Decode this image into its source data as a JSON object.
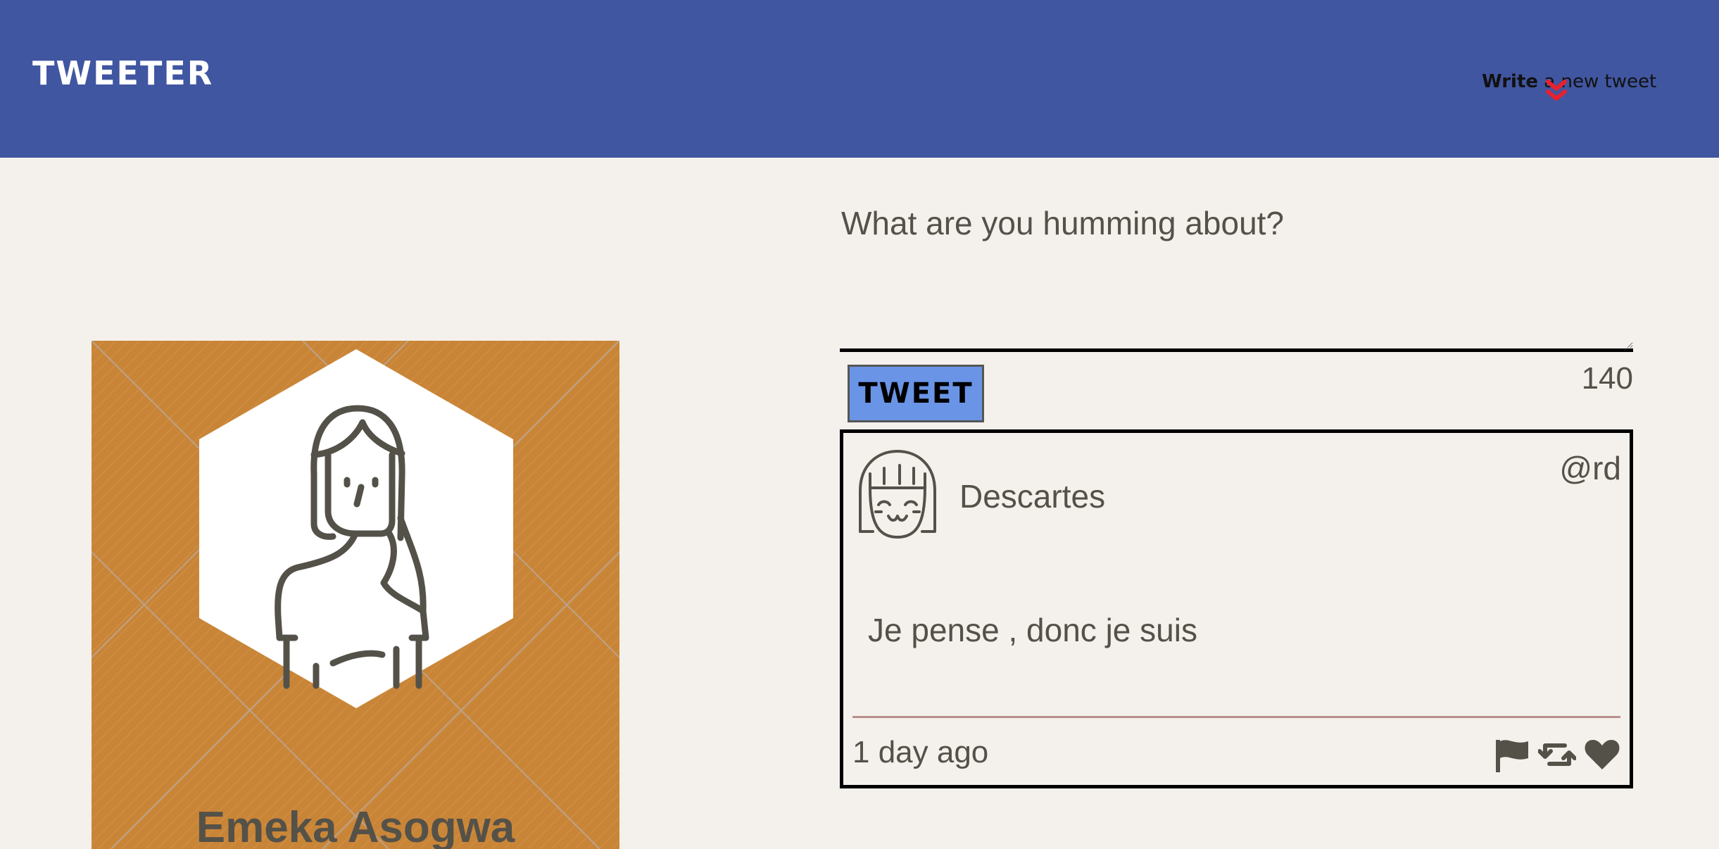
{
  "nav": {
    "brand": "TWEETER",
    "compose_toggle_strong": "Write",
    "compose_toggle_rest": "a new tweet",
    "toggle_icon": "chevron-double-down-icon",
    "toggle_icon_color": "#e8212e",
    "background_color": "#4056a1"
  },
  "profile": {
    "name": "Emeka Asogwa",
    "avatar_icon": "person-avatar-icon",
    "card_color": "#c98537"
  },
  "compose": {
    "placeholder": "What are you humming about?",
    "value": "",
    "button_label": "TWEET",
    "button_color": "#6a94e6",
    "counter": "140"
  },
  "tweets": [
    {
      "name": "Descartes",
      "handle": "@rd",
      "content": "Je pense , donc je suis",
      "time": "1 day ago",
      "avatar_icon": "smiling-person-avatar-icon",
      "actions": [
        "flag-icon",
        "retweet-icon",
        "heart-icon"
      ]
    }
  ],
  "page_background": "#f4f1ec"
}
